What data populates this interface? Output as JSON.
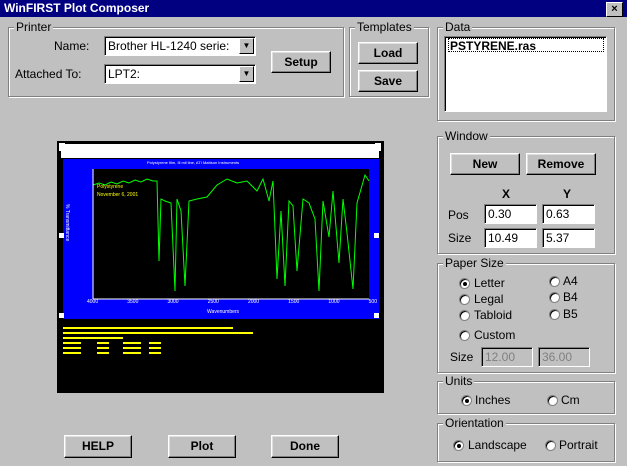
{
  "window": {
    "title": "WinFIRST Plot Composer",
    "close_glyph": "×"
  },
  "printer": {
    "group_label": "Printer",
    "name_label": "Name:",
    "name_value": "Brother HL-1240 serie:",
    "attached_label": "Attached To:",
    "attached_value": "LPT2:",
    "setup_button": "Setup"
  },
  "templates": {
    "group_label": "Templates",
    "load_button": "Load",
    "save_button": "Save"
  },
  "data": {
    "group_label": "Data",
    "items": [
      "PSTYRENE.ras"
    ]
  },
  "window_group": {
    "group_label": "Window",
    "new_button": "New",
    "remove_button": "Remove",
    "x_header": "X",
    "y_header": "Y",
    "pos_label": "Pos",
    "size_label": "Size",
    "pos_x": "0.30",
    "pos_y": "0.63",
    "size_x": "10.49",
    "size_y": "5.37"
  },
  "paper_size": {
    "group_label": "Paper Size",
    "options": [
      "Letter",
      "Legal",
      "Tabloid",
      "Custom",
      "A4",
      "B4",
      "B5"
    ],
    "selected": "Letter",
    "size_label": "Size",
    "custom_w": "12.00",
    "custom_h": "36.00"
  },
  "units": {
    "group_label": "Units",
    "options": [
      "Inches",
      "Cm"
    ],
    "selected": "Inches"
  },
  "orientation": {
    "group_label": "Orientation",
    "options": [
      "Landscape",
      "Portrait"
    ],
    "selected": "Landscape"
  },
  "preview": {
    "plot_title": "Polystyrene film, Ill mil line, ATI Mattson Instruments",
    "sample_label": "Polystyrene",
    "date_label": "November 6, 2001",
    "x_axis_label": "Wavenumbers",
    "x_ticks": [
      "4000",
      "3500",
      "3000",
      "2500",
      "2000",
      "1500",
      "1000",
      "500"
    ],
    "y_axis_label": "% Transmittance"
  },
  "bottom_buttons": {
    "help": "HELP",
    "plot": "Plot",
    "done": "Done"
  },
  "colors": {
    "titlebar": "#000080",
    "preview_bg": "#0000ff",
    "trace": "#00ff00",
    "label": "#ffff00"
  }
}
